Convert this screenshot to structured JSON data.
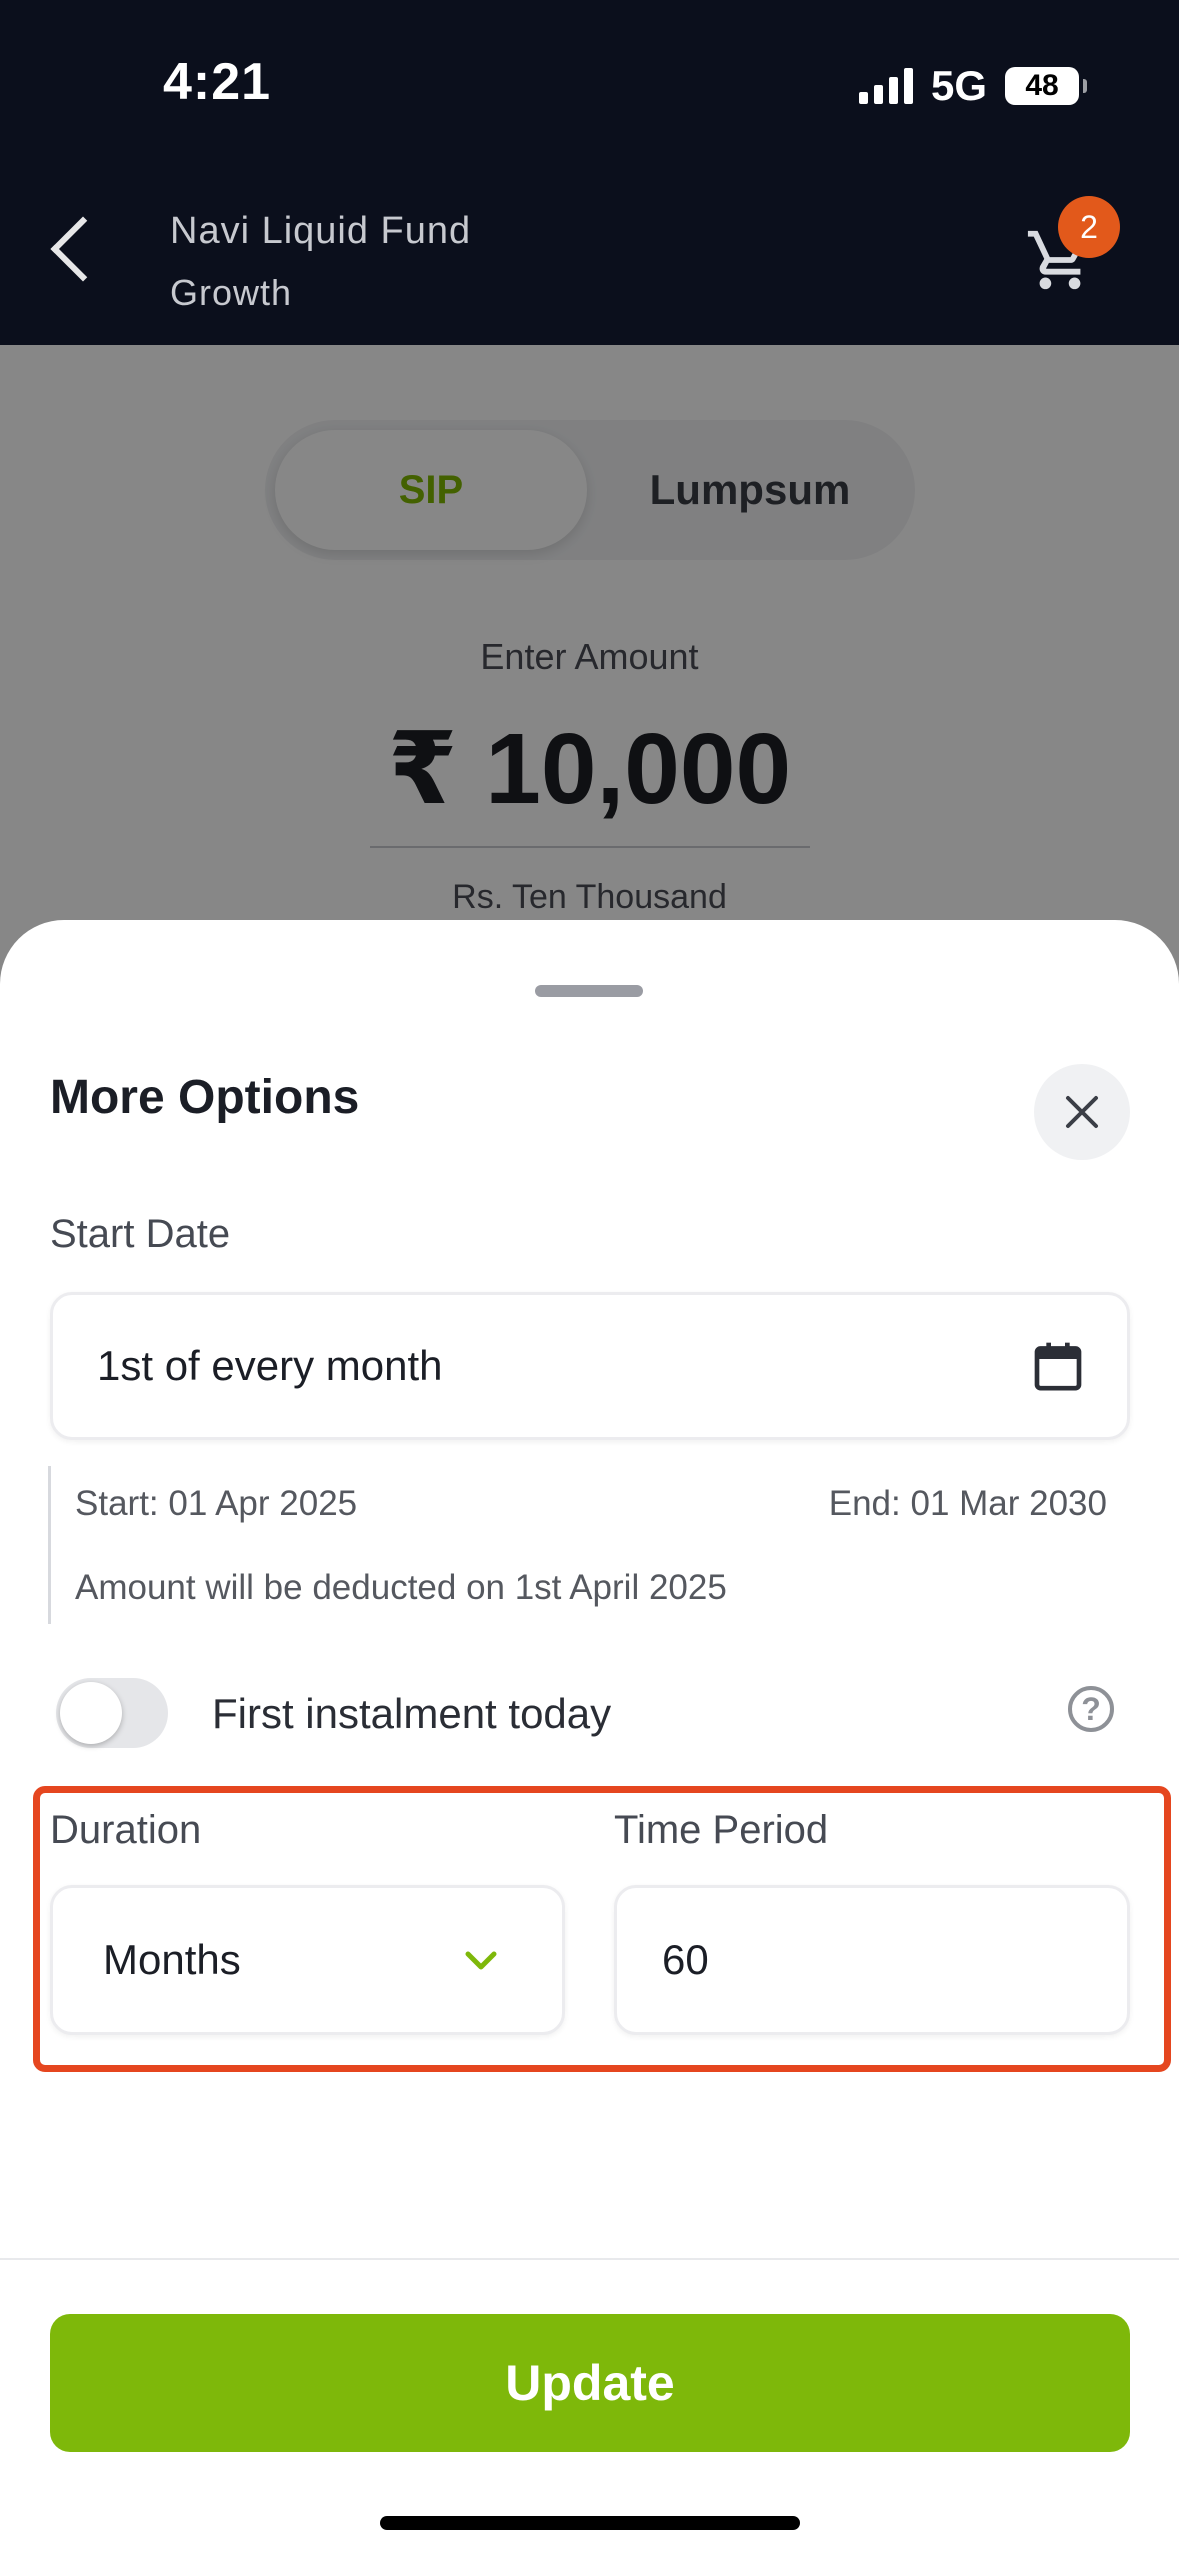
{
  "status_bar": {
    "time": "4:21",
    "network": "5G",
    "battery": "48"
  },
  "header": {
    "fund_name": "Navi Liquid Fund",
    "fund_plan": "Growth",
    "cart_count": "2"
  },
  "background": {
    "tabs": [
      "SIP",
      "Lumpsum"
    ],
    "active_tab": "SIP",
    "enter_amount_label": "Enter Amount",
    "amount": "₹ 10,000",
    "amount_words": "Rs. Ten Thousand"
  },
  "sheet": {
    "title": "More Options",
    "start_date": {
      "label": "Start Date",
      "value": "1st of every month",
      "start_text": "Start: 01 Apr 2025",
      "end_text": "End: 01 Mar 2030",
      "deduction_note": "Amount will be deducted on 1st April 2025"
    },
    "first_instalment": {
      "label": "First instalment today",
      "enabled": false
    },
    "duration": {
      "label": "Duration",
      "value": "Months"
    },
    "time_period": {
      "label": "Time Period",
      "value": "60"
    },
    "update_label": "Update"
  },
  "colors": {
    "accent_green": "#7eb80a",
    "header_bg": "#0b0f1c",
    "badge": "#e2591b",
    "highlight": "#e5461f"
  }
}
